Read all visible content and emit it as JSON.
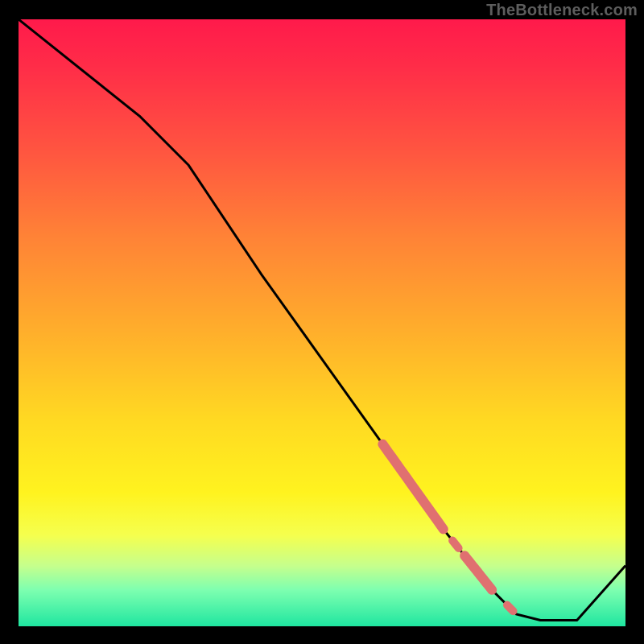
{
  "watermark": "TheBottleneck.com",
  "colors": {
    "frame": "#000000",
    "gradient_top": "#ff1a4b",
    "gradient_bottom": "#1fe6a0",
    "curve": "#000000",
    "marker": "#e07070"
  },
  "chart_data": {
    "type": "line",
    "title": "",
    "xlabel": "",
    "ylabel": "",
    "xlim": [
      0,
      100
    ],
    "ylim": [
      0,
      100
    ],
    "series": [
      {
        "name": "bottleneck-curve",
        "x": [
          0,
          10,
          20,
          28,
          40,
          50,
          60,
          70,
          78,
          82,
          86,
          92,
          100
        ],
        "y": [
          100,
          92,
          84,
          76,
          58,
          44,
          30,
          16,
          6,
          2,
          1,
          1,
          10
        ]
      }
    ],
    "markers": [
      {
        "name": "segment-a",
        "x_start": 60,
        "x_end": 70,
        "thick": true
      },
      {
        "name": "dot-a",
        "x_start": 71.5,
        "x_end": 72.5,
        "thick": false
      },
      {
        "name": "segment-b",
        "x_start": 73.5,
        "x_end": 78,
        "thick": true
      },
      {
        "name": "dot-b",
        "x_start": 80.5,
        "x_end": 81.5,
        "thick": false
      }
    ]
  }
}
